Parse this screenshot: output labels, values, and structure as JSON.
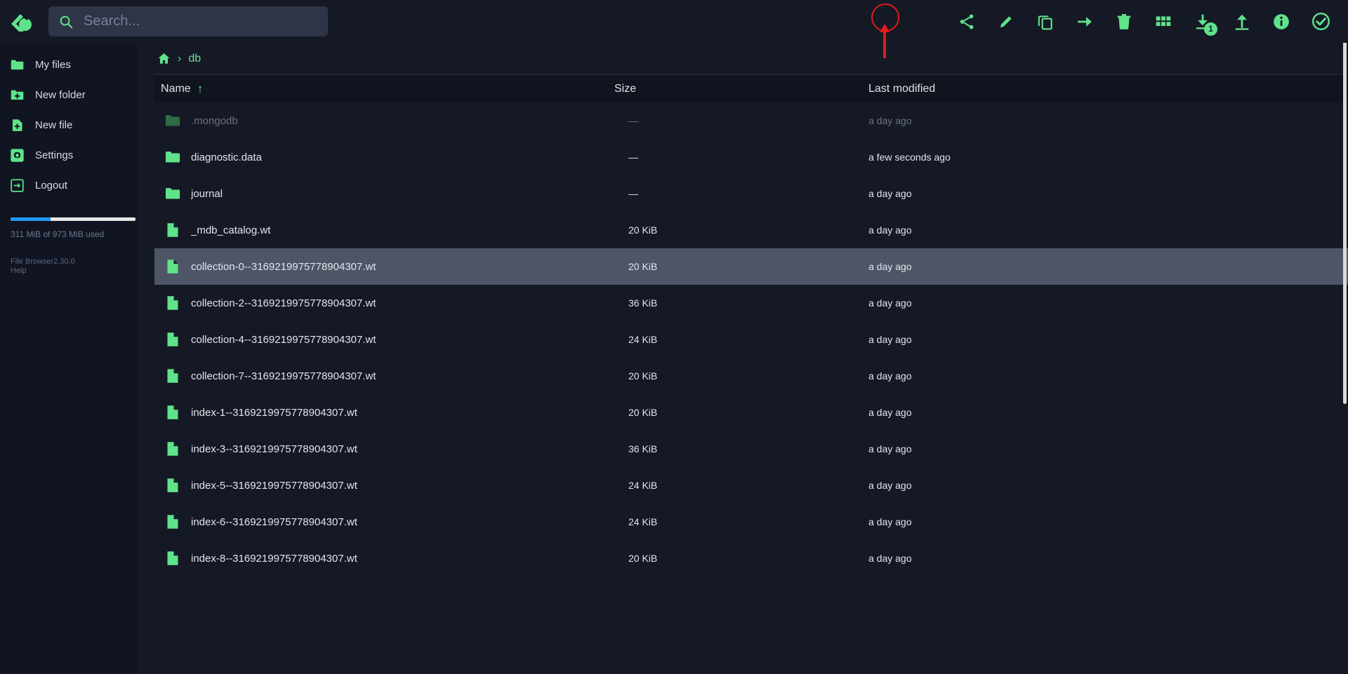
{
  "app": {
    "logo_icon": "filebrowser-logo-icon"
  },
  "search": {
    "placeholder": "Search...",
    "value": "",
    "icon": "search-icon"
  },
  "toolbar": {
    "items": [
      {
        "name": "share-button",
        "icon": "share-icon",
        "label": "Share"
      },
      {
        "name": "rename-button",
        "icon": "pencil-icon",
        "label": "Rename",
        "highlighted": true
      },
      {
        "name": "copy-button",
        "icon": "copy-icon",
        "label": "Copy"
      },
      {
        "name": "move-button",
        "icon": "arrow-right-icon",
        "label": "Move"
      },
      {
        "name": "delete-button",
        "icon": "trash-icon",
        "label": "Delete"
      },
      {
        "name": "switch-view-button",
        "icon": "grid-icon",
        "label": "Switch view"
      },
      {
        "name": "download-button",
        "icon": "download-icon",
        "label": "Download",
        "badge": "1"
      },
      {
        "name": "upload-button",
        "icon": "upload-icon",
        "label": "Upload"
      },
      {
        "name": "info-button",
        "icon": "info-icon",
        "label": "Info"
      },
      {
        "name": "select-button",
        "icon": "check-circle-icon",
        "label": "Select"
      }
    ]
  },
  "sidebar": {
    "items": [
      {
        "label": "My files",
        "icon": "folder-icon"
      },
      {
        "label": "New folder",
        "icon": "folder-plus-icon"
      },
      {
        "label": "New file",
        "icon": "file-plus-icon"
      },
      {
        "label": "Settings",
        "icon": "gear-icon"
      },
      {
        "label": "Logout",
        "icon": "logout-icon"
      }
    ],
    "storage": {
      "text": "311 MiB of 973 MiB used",
      "used_percent": 32,
      "bar_color": "#2196f3"
    },
    "footer": {
      "version": "File Browser2.30.0",
      "help": "Help"
    }
  },
  "breadcrumb": {
    "home_icon": "home-icon",
    "separator": "›",
    "items": [
      {
        "label": "db"
      }
    ]
  },
  "table": {
    "columns": {
      "name": "Name",
      "size": "Size",
      "modified": "Last modified"
    },
    "sort": {
      "column": "Name",
      "direction": "asc",
      "arrow": "↑"
    },
    "rows": [
      {
        "name": ".mongodb",
        "type": "folder",
        "size": "—",
        "modified": "a day ago",
        "hidden": true,
        "selected": false
      },
      {
        "name": "diagnostic.data",
        "type": "folder",
        "size": "—",
        "modified": "a few seconds ago",
        "hidden": false,
        "selected": false
      },
      {
        "name": "journal",
        "type": "folder",
        "size": "—",
        "modified": "a day ago",
        "hidden": false,
        "selected": false
      },
      {
        "name": "_mdb_catalog.wt",
        "type": "file",
        "size": "20 KiB",
        "modified": "a day ago",
        "hidden": false,
        "selected": false
      },
      {
        "name": "collection-0--3169219975778904307.wt",
        "type": "file",
        "size": "20 KiB",
        "modified": "a day ago",
        "hidden": false,
        "selected": true
      },
      {
        "name": "collection-2--3169219975778904307.wt",
        "type": "file",
        "size": "36 KiB",
        "modified": "a day ago",
        "hidden": false,
        "selected": false
      },
      {
        "name": "collection-4--3169219975778904307.wt",
        "type": "file",
        "size": "24 KiB",
        "modified": "a day ago",
        "hidden": false,
        "selected": false
      },
      {
        "name": "collection-7--3169219975778904307.wt",
        "type": "file",
        "size": "20 KiB",
        "modified": "a day ago",
        "hidden": false,
        "selected": false
      },
      {
        "name": "index-1--3169219975778904307.wt",
        "type": "file",
        "size": "20 KiB",
        "modified": "a day ago",
        "hidden": false,
        "selected": false
      },
      {
        "name": "index-3--3169219975778904307.wt",
        "type": "file",
        "size": "36 KiB",
        "modified": "a day ago",
        "hidden": false,
        "selected": false
      },
      {
        "name": "index-5--3169219975778904307.wt",
        "type": "file",
        "size": "24 KiB",
        "modified": "a day ago",
        "hidden": false,
        "selected": false
      },
      {
        "name": "index-6--3169219975778904307.wt",
        "type": "file",
        "size": "24 KiB",
        "modified": "a day ago",
        "hidden": false,
        "selected": false
      },
      {
        "name": "index-8--3169219975778904307.wt",
        "type": "file",
        "size": "20 KiB",
        "modified": "a day ago",
        "hidden": false,
        "selected": false
      }
    ]
  },
  "annotation": {
    "color": "#e01b1b",
    "target": "rename-button"
  },
  "colors": {
    "accent_green": "#5fe38a",
    "background": "#141925",
    "sidebar": "#101521",
    "selected_row": "#4e5566"
  }
}
